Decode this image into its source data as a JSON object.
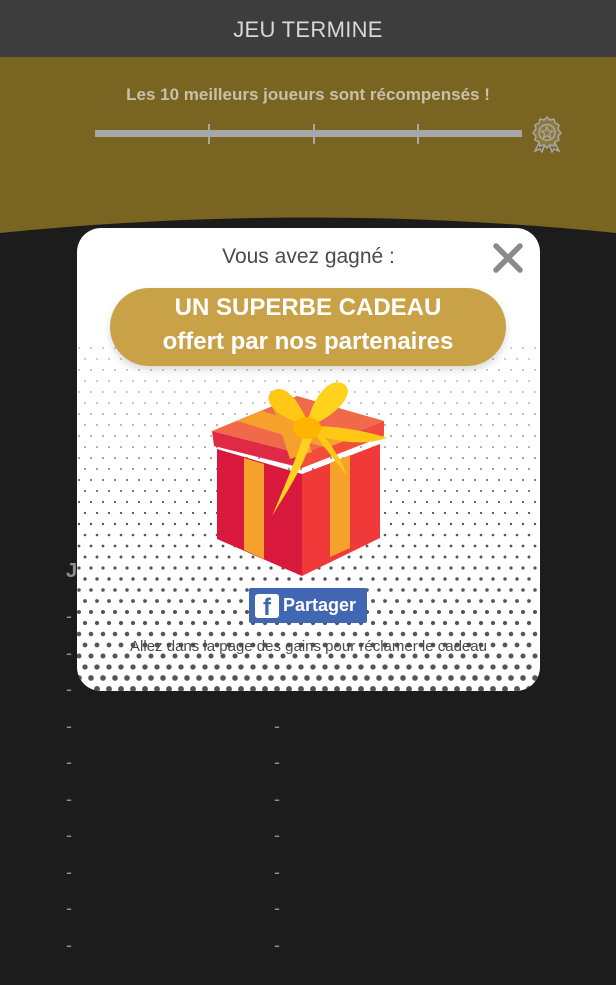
{
  "header": {
    "title": "JEU TERMINE"
  },
  "reward_banner": {
    "text": "Les 10 meilleurs joueurs sont récompensés !",
    "award_icon": "award-badge-icon"
  },
  "leaderboard": {
    "header": "J",
    "rows": [
      [
        "-",
        ""
      ],
      [
        "-",
        ""
      ],
      [
        "-",
        ""
      ],
      [
        "-",
        "-"
      ],
      [
        "-",
        "-"
      ],
      [
        "-",
        "-"
      ],
      [
        "-",
        "-"
      ],
      [
        "-",
        "-"
      ],
      [
        "-",
        "-"
      ],
      [
        "-",
        "-"
      ]
    ]
  },
  "modal": {
    "title": "Vous avez gagné :",
    "close_icon": "close-icon",
    "prize_line1": "UN SUPERBE CADEAU",
    "prize_line2": "offert par nos partenaires",
    "gift_icon": "gift-box-icon",
    "share_label": "Partager",
    "share_icon": "facebook-icon",
    "footer": "Allez dans la page des gains pour réclamer le cadeau"
  },
  "colors": {
    "top_bar": "#3d3d3d",
    "gold_band": "#7a6422",
    "page_background": "#1c1c1c",
    "prize_pill": "#c9a248",
    "facebook_blue": "#4267b2"
  }
}
